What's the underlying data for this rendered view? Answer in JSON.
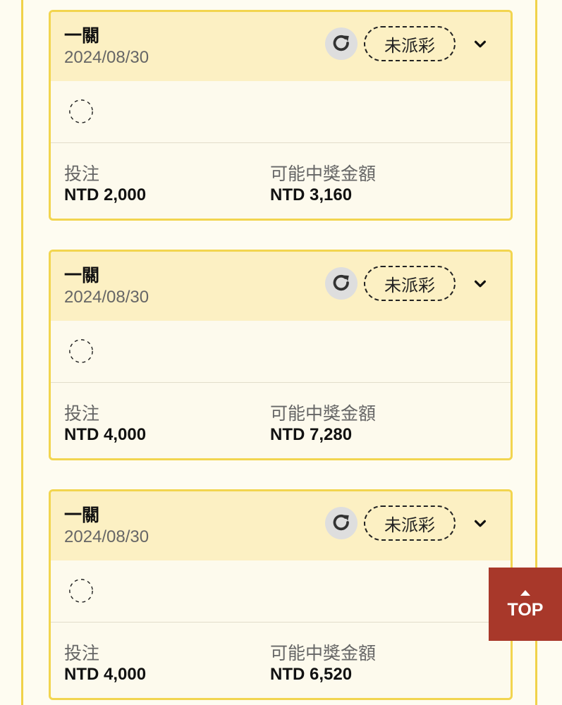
{
  "cards": [
    {
      "title": "一關",
      "date": "2024/08/30",
      "status": "未派彩",
      "stake_label": "投注",
      "stake_value": "NTD 2,000",
      "payout_label": "可能中獎金額",
      "payout_value": "NTD 3,160"
    },
    {
      "title": "一關",
      "date": "2024/08/30",
      "status": "未派彩",
      "stake_label": "投注",
      "stake_value": "NTD 4,000",
      "payout_label": "可能中獎金額",
      "payout_value": "NTD 7,280"
    },
    {
      "title": "一關",
      "date": "2024/08/30",
      "status": "未派彩",
      "stake_label": "投注",
      "stake_value": "NTD 4,000",
      "payout_label": "可能中獎金額",
      "payout_value": "NTD 6,520"
    }
  ],
  "top_button": {
    "label": "TOP",
    "icon": "caret-up-icon"
  },
  "colors": {
    "card_border": "#f2d54f",
    "card_header": "#fcf0c3",
    "page_background": "#fefcf1",
    "top_button": "#a8382a"
  },
  "icons": {
    "refresh": "refresh-icon",
    "expand": "chevron-down-icon",
    "loading": "loading-icon"
  }
}
